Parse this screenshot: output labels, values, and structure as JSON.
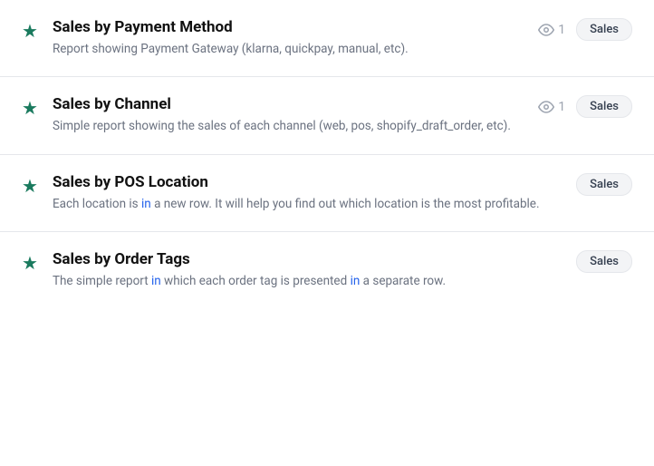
{
  "reports": [
    {
      "id": "payment-method",
      "title": "Sales by Payment Method",
      "description": "Report showing Payment Gateway (klarna, quickpay, manual, etc).",
      "description_parts": [
        {
          "text": "Report showing Payment Gateway (klarna, quickpay, manual, etc).",
          "highlight": false
        }
      ],
      "has_view_count": true,
      "view_count": "1",
      "badge": "Sales",
      "starred": true
    },
    {
      "id": "channel",
      "title": "Sales by Channel",
      "description": "Simple report showing the sales of each channel (web, pos, shopify_draft_order, etc).",
      "description_parts": [
        {
          "text": "Simple report showing the sales of each channel (web, pos, shopify_draft_order, etc).",
          "highlight": false
        }
      ],
      "has_view_count": true,
      "view_count": "1",
      "badge": "Sales",
      "starred": true
    },
    {
      "id": "pos-location",
      "title": "Sales by POS Location",
      "description_parts": [
        {
          "text": "Each location is ",
          "highlight": false
        },
        {
          "text": "in",
          "highlight": true
        },
        {
          "text": " a new row. It will help you find out which location is the most profitable.",
          "highlight": false
        }
      ],
      "has_view_count": false,
      "view_count": "",
      "badge": "Sales",
      "starred": true
    },
    {
      "id": "order-tags",
      "title": "Sales by Order Tags",
      "description_parts": [
        {
          "text": "The simple report ",
          "highlight": false
        },
        {
          "text": "in",
          "highlight": true
        },
        {
          "text": " which each order tag is presented ",
          "highlight": false
        },
        {
          "text": "in",
          "highlight": true
        },
        {
          "text": " a separate row.",
          "highlight": false
        }
      ],
      "has_view_count": false,
      "view_count": "",
      "badge": "Sales",
      "starred": true
    }
  ],
  "icons": {
    "star": "★",
    "eye": "eye"
  },
  "colors": {
    "star": "#1a7a5e",
    "highlight": "#2563eb",
    "badge_bg": "#f3f4f6",
    "divider": "#e5e7eb"
  }
}
